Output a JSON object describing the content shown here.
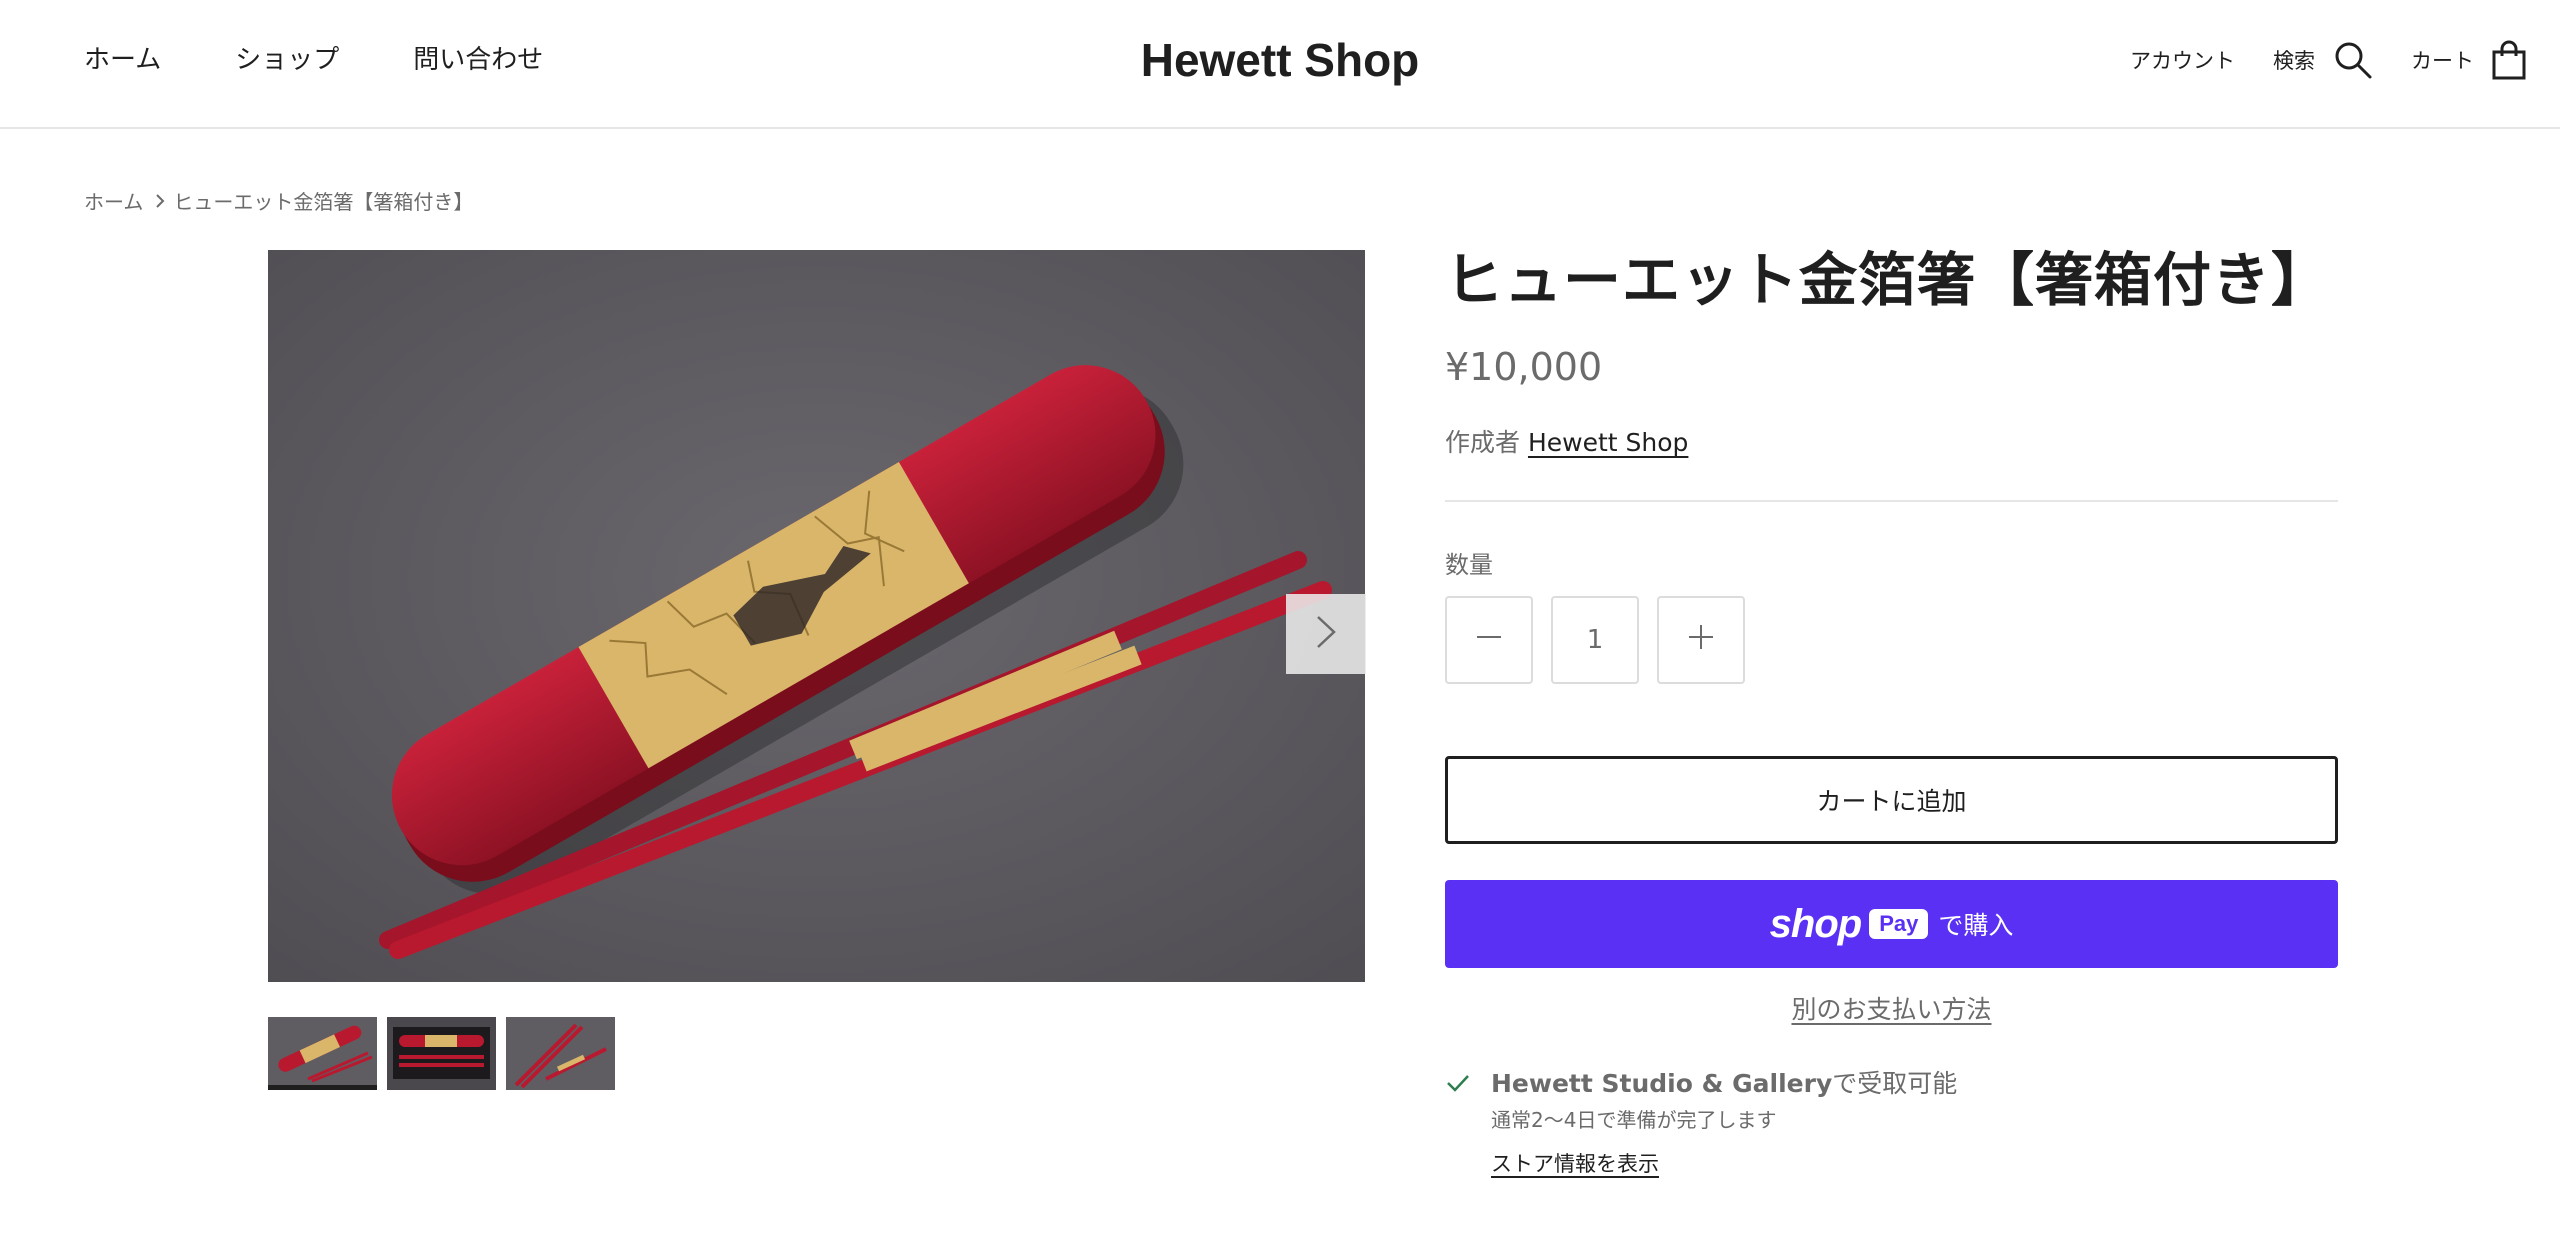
{
  "header": {
    "nav": [
      "ホーム",
      "ショップ",
      "問い合わせ"
    ],
    "brand": "Hewett Shop",
    "account_label": "アカウント",
    "search_label": "検索",
    "cart_label": "カート"
  },
  "breadcrumb": {
    "home": "ホーム",
    "current": "ヒューエット金箔箸【箸箱付き】"
  },
  "gallery": {
    "thumbnail_count": 3,
    "active_thumbnail": 1
  },
  "product": {
    "title": "ヒューエット金箔箸【箸箱付き】",
    "price": "¥10,000",
    "vendor_prefix": "作成者",
    "vendor": "Hewett Shop",
    "quantity_label": "数量",
    "quantity": "1",
    "add_to_cart": "カートに追加",
    "shop_pay_word": "shop",
    "shop_pay_badge": "Pay",
    "shop_pay_suffix": "で購入",
    "more_payment": "別のお支払い方法",
    "pickup_location": "Hewett Studio & Gallery",
    "pickup_suffix": "で受取可能",
    "pickup_time": "通常2〜4日で準備が完了します",
    "store_info_link": "ストア情報を表示"
  },
  "colors": {
    "shop_pay": "#5a31f4",
    "text": "#1f1f1f",
    "muted": "#6b6b6b",
    "check": "#2e7d4f"
  }
}
